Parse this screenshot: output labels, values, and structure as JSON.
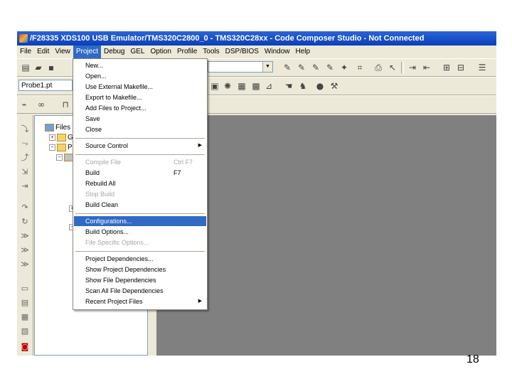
{
  "window": {
    "title": "/F28335 XDS100 USB Emulator/TMS320C2800_0 - TMS320C28xx - Code Composer Studio - Not Connected"
  },
  "menubar": {
    "items": [
      "File",
      "Edit",
      "View",
      "Project",
      "Debug",
      "GEL",
      "Option",
      "Profile",
      "Tools",
      "DSP/BIOS",
      "Window",
      "Help"
    ],
    "active": "Project"
  },
  "toolbar": {
    "project_combo": "Probe1.pt"
  },
  "tree": {
    "root": "Files",
    "child1": "G",
    "child2": "Pr"
  },
  "project_menu": {
    "items": [
      {
        "label": "New...",
        "disabled": false
      },
      {
        "label": "Open...",
        "disabled": false
      },
      {
        "label": "Use External Makefile...",
        "disabled": false
      },
      {
        "label": "Export to Makefile...",
        "disabled": false
      },
      {
        "label": "Add Files to Project...",
        "disabled": false
      },
      {
        "label": "Save",
        "disabled": false
      },
      {
        "label": "Close",
        "disabled": false
      },
      {
        "label": "Source Control",
        "disabled": false,
        "submenu": true
      },
      {
        "label": "Compile File",
        "disabled": true,
        "shortcut": "Ctrl F7"
      },
      {
        "label": "Build",
        "disabled": false,
        "shortcut": "F7"
      },
      {
        "label": "Rebuild All",
        "disabled": false
      },
      {
        "label": "Stop Build",
        "disabled": true
      },
      {
        "label": "Build Clean",
        "disabled": false
      },
      {
        "label": "Configurations...",
        "disabled": false,
        "selected": true
      },
      {
        "label": "Build Options...",
        "disabled": false
      },
      {
        "label": "File Specific Options...",
        "disabled": true
      },
      {
        "label": "Project Dependencies...",
        "disabled": false
      },
      {
        "label": "Show Project Dependencies",
        "disabled": false
      },
      {
        "label": "Show File Dependencies",
        "disabled": false
      },
      {
        "label": "Scan All File Dependencies",
        "disabled": false
      },
      {
        "label": "Recent Project Files",
        "disabled": false,
        "submenu": true
      }
    ]
  },
  "slide": {
    "page_number": "18"
  },
  "colors": {
    "titlebar": "#0a3fb8",
    "menu_highlight": "#316ac5",
    "workspace": "#808080"
  }
}
